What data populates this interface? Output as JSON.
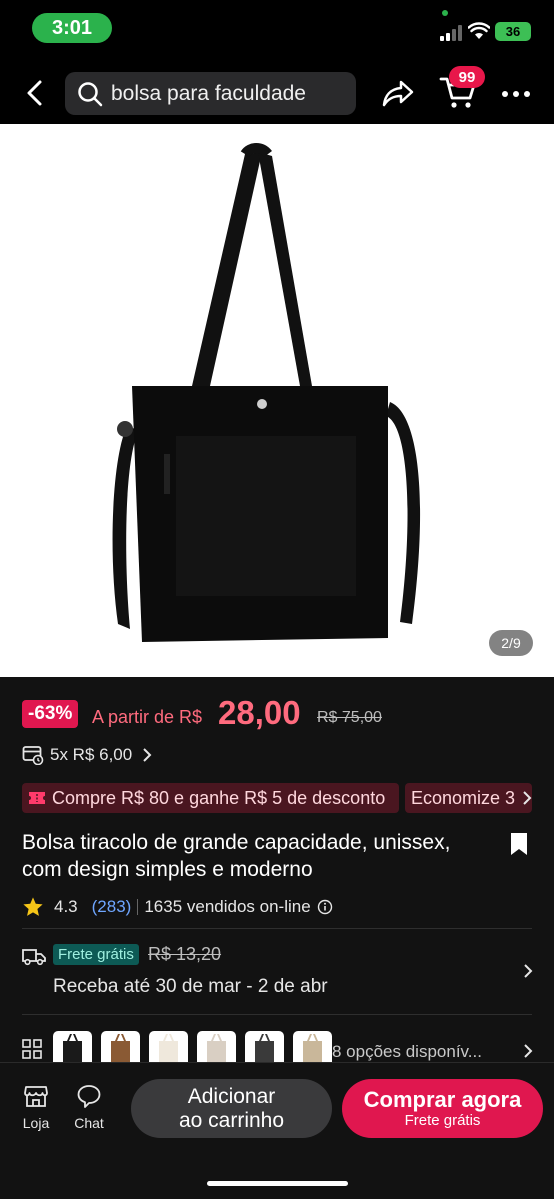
{
  "status_bar": {
    "time": "3:01",
    "battery": "36"
  },
  "header": {
    "search_text": "bolsa para faculdade",
    "cart_badge": "99"
  },
  "gallery": {
    "counter": "2/9"
  },
  "price": {
    "discount": "-63%",
    "prefix": "A partir de R$",
    "value": "28,00",
    "original": "R$ 75,00"
  },
  "installments": {
    "text": "5x R$ 6,00"
  },
  "promos": [
    {
      "label": "Compre R$ 80 e ganhe R$ 5 de desconto"
    },
    {
      "label": "Economize 3"
    }
  ],
  "product": {
    "title": "Bolsa tiracolo de grande capacidade, unissex, com design simples e moderno"
  },
  "rating": {
    "value": "4.3",
    "count": "(283)",
    "sold": "1635 vendidos on-line"
  },
  "shipping": {
    "free_label": "Frete grátis",
    "old_price": "R$ 13,20",
    "delivery": "Receba até 30 de mar - 2 de abr"
  },
  "variants": {
    "text": "8 opções disponív...",
    "thumb_colors": [
      "#1a1a1a",
      "#8a5a34",
      "#efe8dc",
      "#d9cfc3",
      "#3a3a3a",
      "#c9b79a"
    ]
  },
  "bottom_bar": {
    "store_label": "Loja",
    "chat_label": "Chat",
    "add_to_cart_line1": "Adicionar",
    "add_to_cart_line2": "ao carrinho",
    "buy_now": "Comprar agora",
    "buy_now_sub": "Frete grátis"
  },
  "colors": {
    "accent": "#e0174f",
    "price": "#ff6b7e",
    "free_shipping_bg": "#0d5a55",
    "rating_count": "#6fa6ff"
  }
}
